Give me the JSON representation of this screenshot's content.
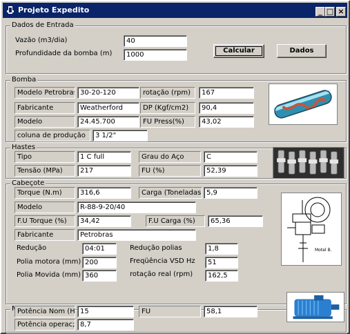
{
  "window": {
    "title": "Projeto Expedito"
  },
  "entrada": {
    "title": "Dados de Entrada",
    "vazao_label": "Vazão (m3/dia)",
    "vazao_value": "40",
    "prof_label": "Profundidade da bomba (m)",
    "prof_value": "1000",
    "calcular": "Calcular",
    "dados": "Dados"
  },
  "bomba": {
    "title": "Bomba",
    "modelo_petrobras_label": "Modelo Petrobras",
    "modelo_petrobras_value": "30-20-120",
    "rotacao_label": "rotação (rpm)",
    "rotacao_value": "167",
    "fabricante_label": "Fabricante",
    "fabricante_value": "Weatherford",
    "dp_label": "DP (Kgf/cm2)",
    "dp_value": "90,4",
    "modelo_label": "Modelo",
    "modelo_value": "24.45.700",
    "fu_label": "FU Press(%)",
    "fu_value": "43,02",
    "coluna_label": "coluna de produção",
    "coluna_value": "3 1/2\""
  },
  "hastes": {
    "title": "Hastes",
    "tipo_label": "Tipo",
    "tipo_value": "1 C full",
    "grau_label": "Grau do Aço",
    "grau_value": "C",
    "tensao_label": "Tensão (MPa)",
    "tensao_value": "217",
    "fu_label": "FU (%)",
    "fu_value": "52,39"
  },
  "cabecote": {
    "title": "Cabeçote",
    "torque_label": "Torque (N.m)",
    "torque_value": "316,6",
    "carga_label": "Carga (Toneladas)",
    "carga_value": "5,9",
    "modelo_label": "Modelo",
    "modelo_value": "R-88-9-20/40",
    "fu_torque_label": "F.U Torque (%)",
    "fu_torque_value": "34,42",
    "fu_carga_label": "F.U Carga (%)",
    "fu_carga_value": "65,36",
    "fabricante_label": "Fabricante",
    "fabricante_value": "Petrobras",
    "reducao_label": "Redução",
    "reducao_value": "04:01",
    "reducao_polias_label": "Redução polias",
    "reducao_polias_value": "1,8",
    "polia_motora_label": "Polia motora (mm)",
    "polia_motora_value": "200",
    "freq_label": "Freqüência VSD Hz",
    "freq_value": "51",
    "polia_movida_label": "Polia Movida (mm)",
    "polia_movida_value": "360",
    "rotacao_real_label": "rotação real (rpm)",
    "rotacao_real_value": "162,5",
    "image_caption": "Motel B."
  },
  "motor": {
    "title": "Motor",
    "pot_nom_label": "Potência Nom (HP",
    "pot_nom_value": "15",
    "fu_label": "FU",
    "fu_value": "58,1",
    "pot_oper_label": "Potência operac;",
    "pot_oper_value": "8,7"
  },
  "colors": {
    "titlebar": "#0a246a",
    "face": "#d4d0c8"
  }
}
